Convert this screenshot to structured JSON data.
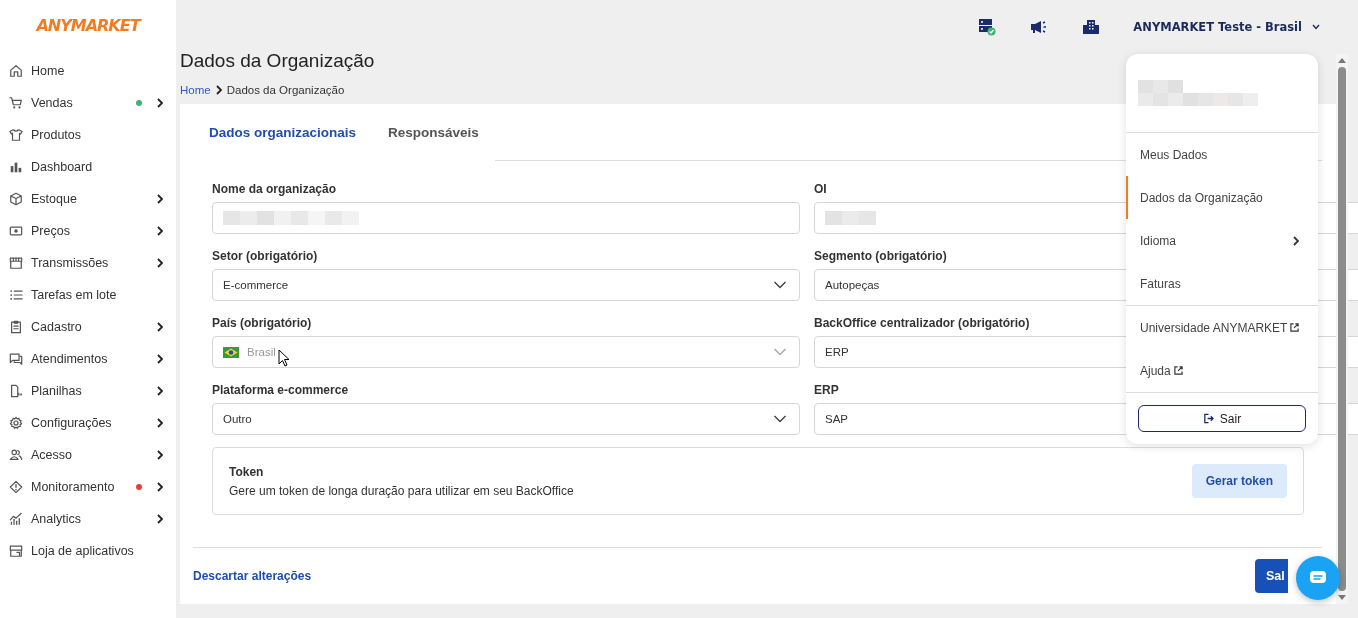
{
  "sidebar": {
    "logo": "ANYMARKET",
    "items": [
      {
        "label": "Home",
        "has_submenu": false
      },
      {
        "label": "Vendas",
        "has_submenu": true,
        "color": "#3cb371"
      },
      {
        "label": "Produtos",
        "has_submenu": false
      },
      {
        "label": "Dashboard",
        "has_submenu": false
      },
      {
        "label": "Estoque",
        "has_submenu": true
      },
      {
        "label": "Preços",
        "has_submenu": true
      },
      {
        "label": "Transmissões",
        "has_submenu": true
      },
      {
        "label": "Tarefas em lote",
        "has_submenu": false
      },
      {
        "label": "Cadastro",
        "has_submenu": true
      },
      {
        "label": "Atendimentos",
        "has_submenu": true
      },
      {
        "label": "Planilhas",
        "has_submenu": true
      },
      {
        "label": "Configurações",
        "has_submenu": true
      },
      {
        "label": "Acesso",
        "has_submenu": true
      },
      {
        "label": "Monitoramento",
        "has_submenu": true,
        "color": "#f03a3a"
      },
      {
        "label": "Analytics",
        "has_submenu": true
      },
      {
        "label": "Loja de aplicativos",
        "has_submenu": false
      }
    ]
  },
  "topbar": {
    "account": "ANYMARKET Teste - Brasil"
  },
  "page": {
    "title": "Dados da Organização",
    "breadcrumb": [
      {
        "label": "Home",
        "kind": "link"
      },
      {
        "label": "Dados da Organização",
        "kind": "current"
      }
    ]
  },
  "tabs": [
    {
      "label": "Dados organizacionais",
      "selected": true
    },
    {
      "label": "Responsáveis",
      "selected": false
    }
  ],
  "fields": [
    {
      "label": "Nome da organização",
      "kind": "redacted"
    },
    {
      "label": "OI",
      "kind": "redacted"
    },
    {
      "label": "Setor (obrigatório)",
      "kind": "select",
      "value": "E-commerce",
      "disabled": false
    },
    {
      "label": "Segmento (obrigatório)",
      "kind": "input",
      "value": "Autopeças",
      "disabled": false
    },
    {
      "label": "País (obrigatório)",
      "kind": "select",
      "value": "Brasil",
      "disabled": true
    },
    {
      "label": "BackOffice centralizador (obrigatório)",
      "kind": "input",
      "value": "ERP",
      "disabled": false
    },
    {
      "label": "Plataforma e-commerce",
      "kind": "select",
      "value": "Outro",
      "disabled": false
    },
    {
      "label": "ERP",
      "kind": "input",
      "value": "SAP",
      "disabled": false
    }
  ],
  "token": {
    "title": "Token",
    "description": "Gere um token de longa duração para utilizar em seu BackOffice",
    "button": "Gerar token"
  },
  "footer": {
    "discard": "Descartar alterações",
    "save": "Sal"
  },
  "user_menu": {
    "sections": [
      [
        {
          "label": "Meus Dados",
          "kind": "plain",
          "selected": false
        },
        {
          "label": "Dados da Organização",
          "kind": "plain",
          "selected": true
        },
        {
          "label": "Idioma",
          "kind": "submenu",
          "selected": false
        },
        {
          "label": "Faturas",
          "kind": "plain",
          "selected": false
        }
      ],
      [
        {
          "label": "Universidade ANYMARKET",
          "kind": "external",
          "selected": false
        },
        {
          "label": "Ajuda",
          "kind": "external",
          "selected": false
        }
      ]
    ],
    "logout": "Sair"
  }
}
